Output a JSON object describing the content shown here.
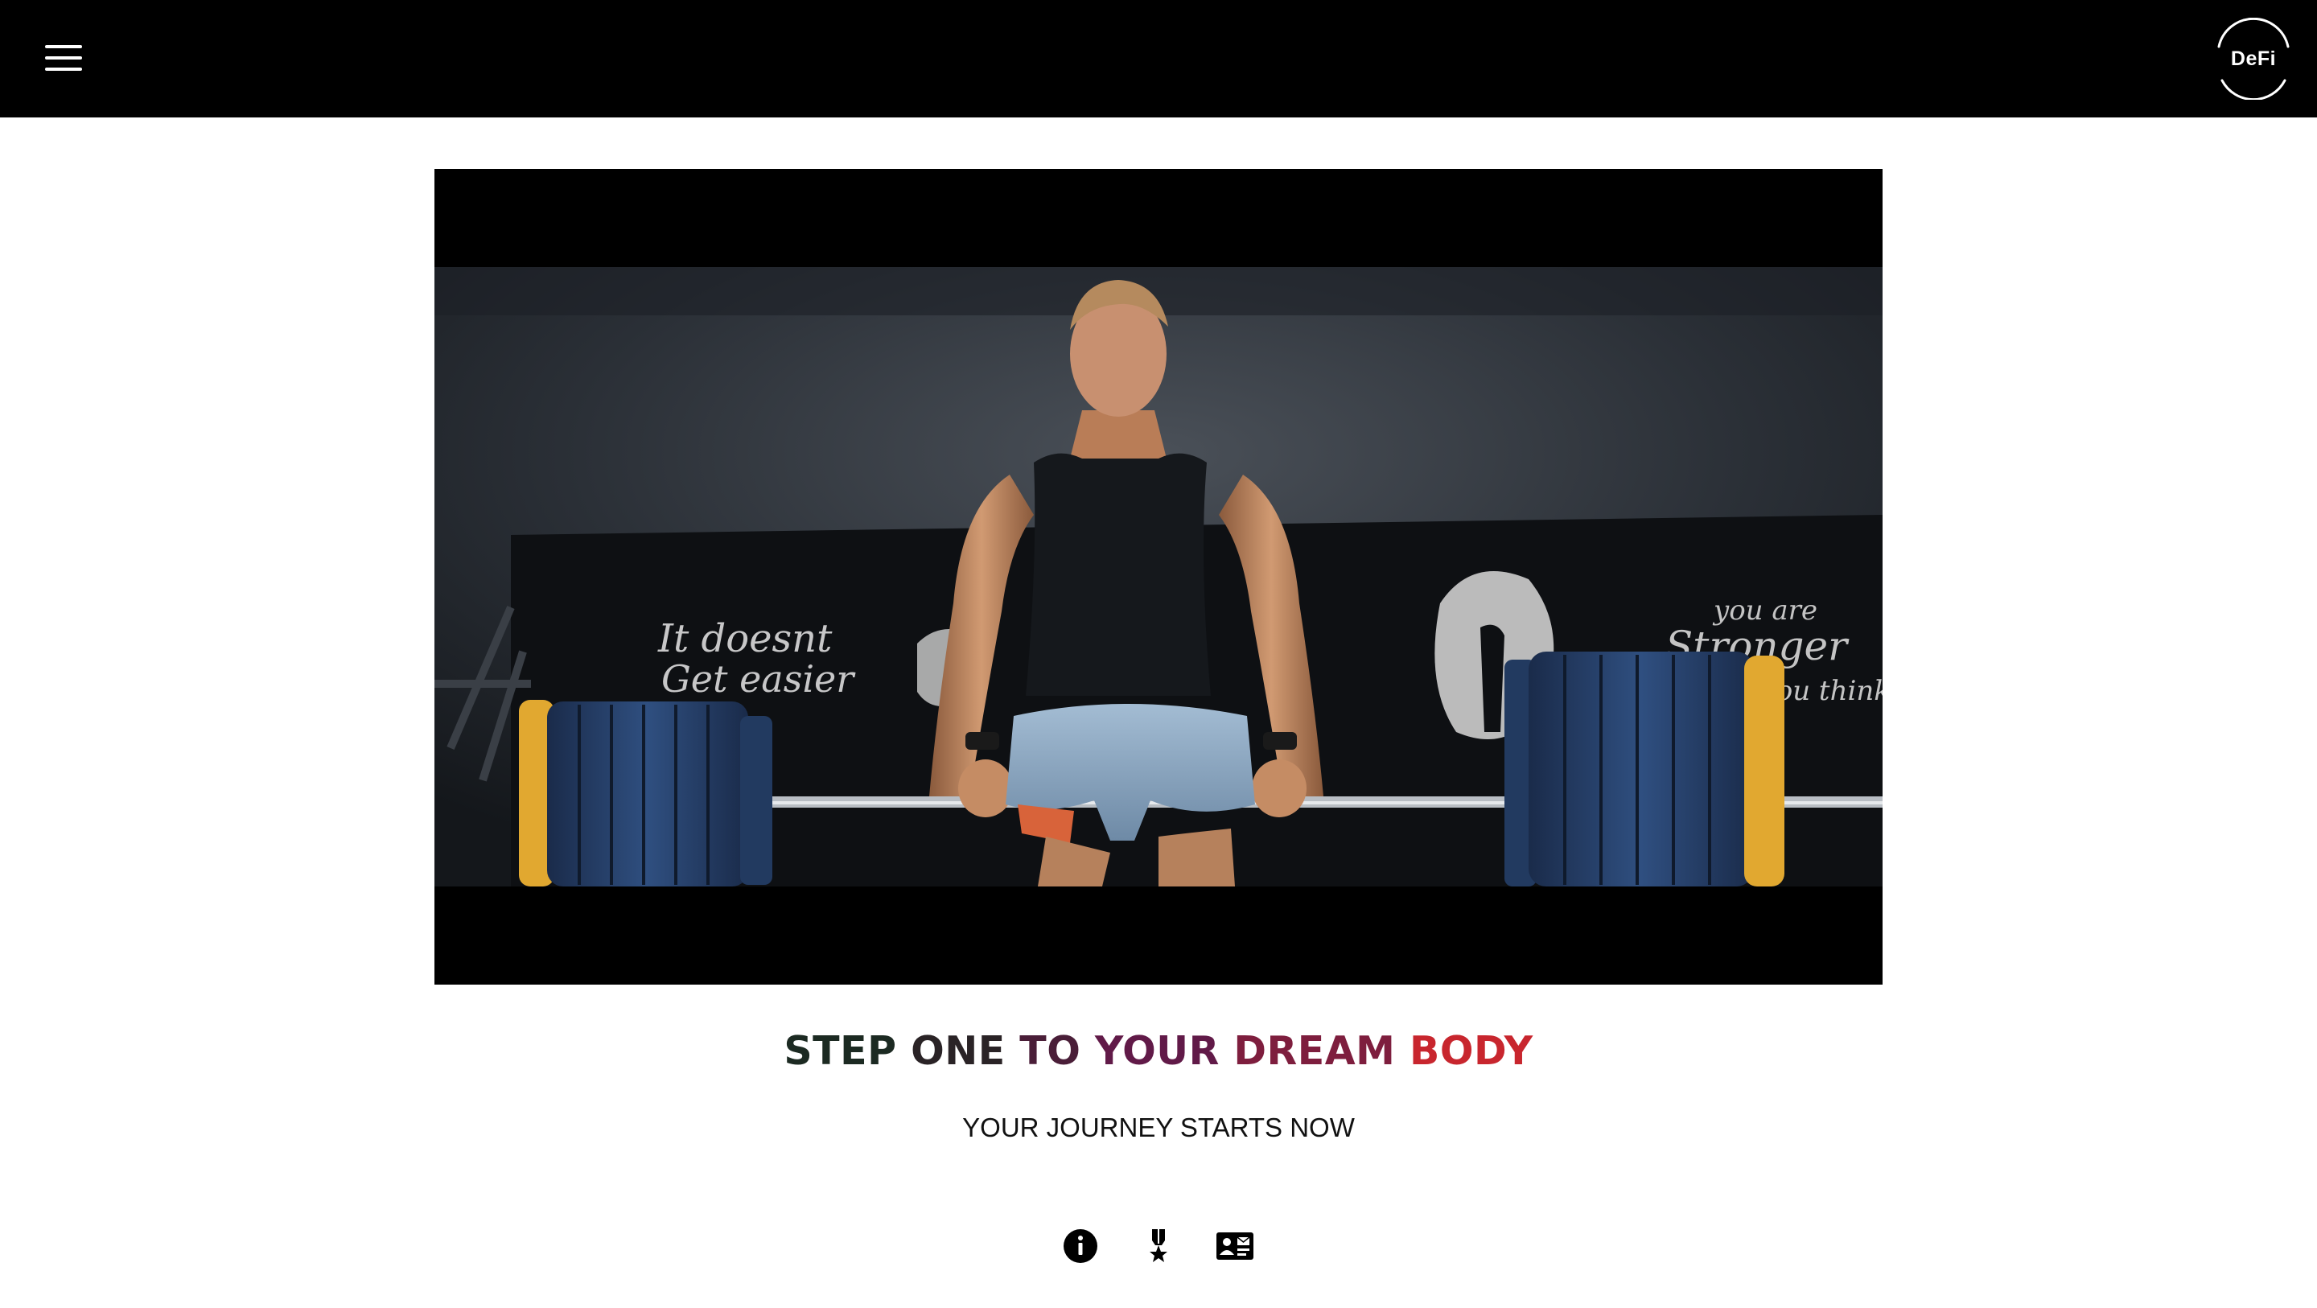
{
  "header": {
    "menu_icon": "hamburger-menu-icon",
    "logo_text": "DeFi"
  },
  "video": {
    "scene_lettering": [
      "It doesnt Get easier",
      "you are Stronger"
    ]
  },
  "hero": {
    "headline_words": [
      {
        "text": "STEP ",
        "color": "#1c2a22"
      },
      {
        "text": "ONE ",
        "color": "#2a2326"
      },
      {
        "text": "TO ",
        "color": "#4a1e38"
      },
      {
        "text": "YOUR ",
        "color": "#611a48"
      },
      {
        "text": "DREAM ",
        "color": "#7e1e3e"
      },
      {
        "text": "BODY",
        "color": "#c8262e"
      }
    ],
    "subtitle": "YOUR JOURNEY STARTS NOW"
  },
  "footer_icons": [
    "info-icon",
    "medal-icon",
    "contact-card-icon"
  ],
  "colors": {
    "topbar": "#000000",
    "background": "#ffffff",
    "accent_red": "#c8262e"
  }
}
